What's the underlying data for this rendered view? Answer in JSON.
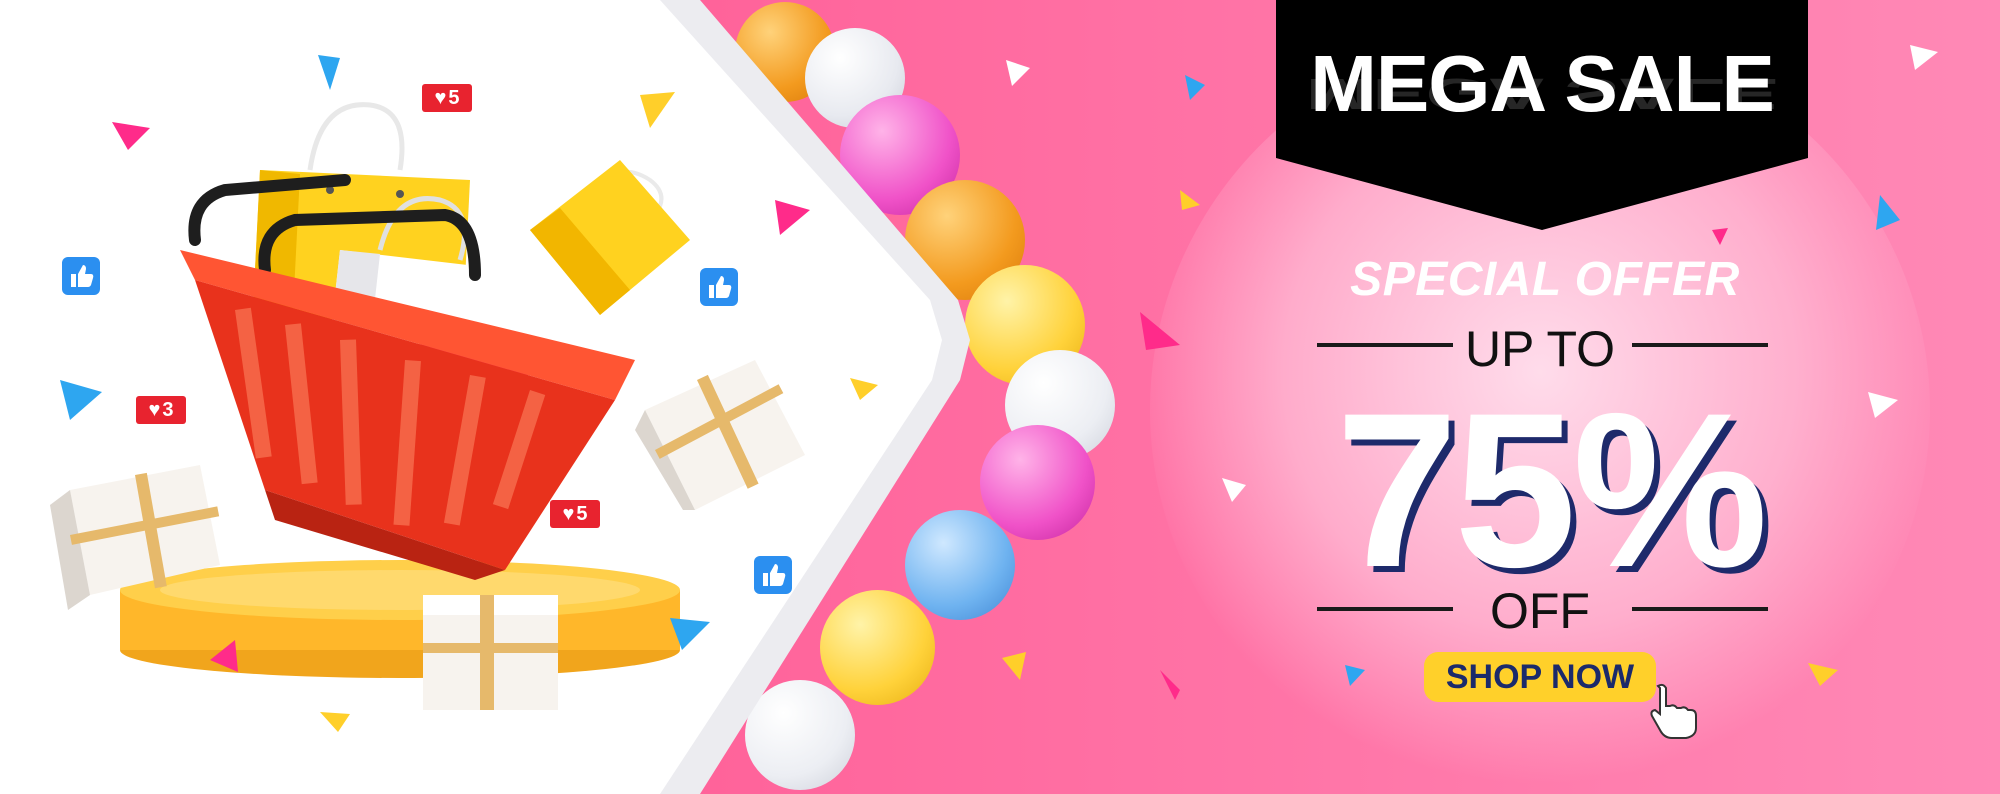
{
  "banner": {
    "headline": "MEGA SALE",
    "subheadline": "SPECIAL OFFER",
    "up_to": "UP TO",
    "discount": "75%",
    "off": "OFF",
    "cta_label": "SHOP NOW"
  },
  "badges": {
    "heart_top": "5",
    "heart_left": "3",
    "heart_bottom": "5"
  },
  "colors": {
    "background_pink": "#ff5f98",
    "tag_black": "#000000",
    "cta_yellow": "#ffd02a",
    "cta_text": "#1b2a6b",
    "basket_red": "#e8321c",
    "podium_yellow": "#ffb72a",
    "like_blue": "#2b8ff0",
    "heart_red": "#e8232f"
  },
  "icons": [
    "shopping-basket-icon",
    "shopping-bag-icon",
    "gift-box-icon",
    "podium-icon",
    "balloon-icon",
    "like-icon",
    "heart-icon",
    "pointer-hand-icon",
    "confetti-icon"
  ]
}
